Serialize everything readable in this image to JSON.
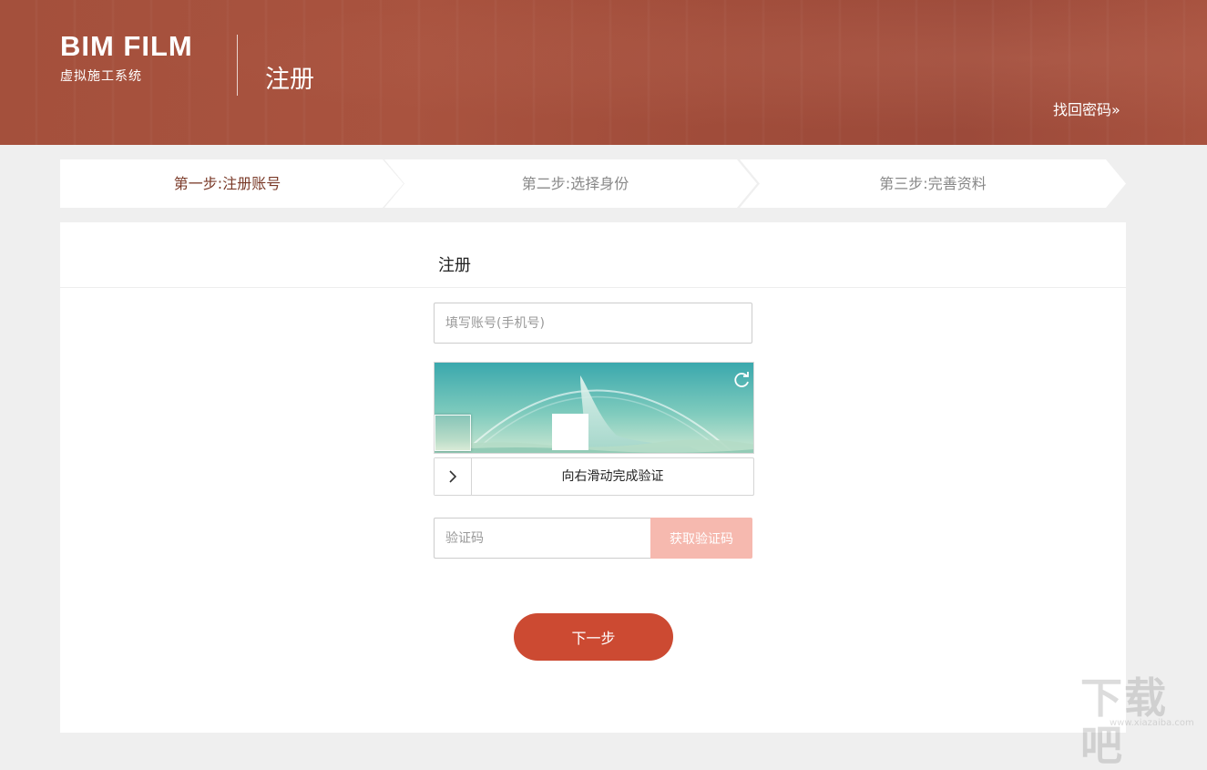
{
  "header": {
    "logo": "BIM FILM",
    "logo_subtitle": "虚拟施工系统",
    "title": "注册",
    "recover_link": "找回密码»"
  },
  "steps": [
    {
      "label": "第一步:注册账号",
      "active": true
    },
    {
      "label": "第二步:选择身份",
      "active": false
    },
    {
      "label": "第三步:完善资料",
      "active": false
    }
  ],
  "form": {
    "title": "注册",
    "account_placeholder": "填写账号(手机号)",
    "captcha_icon": "refresh-icon",
    "slider_icon": "chevron-right-icon",
    "slider_text": "向右滑动完成验证",
    "code_placeholder": "验证码",
    "get_code_label": "获取验证码",
    "next_label": "下一步"
  },
  "watermark": {
    "text": "下载吧",
    "url": "www.xiazaiba.com"
  },
  "colors": {
    "header_bg": "#a4503c",
    "active_step": "#7a3a28",
    "primary_button": "#cc4a32",
    "disabled_button": "#f6b9af",
    "page_bg": "#efefef"
  }
}
